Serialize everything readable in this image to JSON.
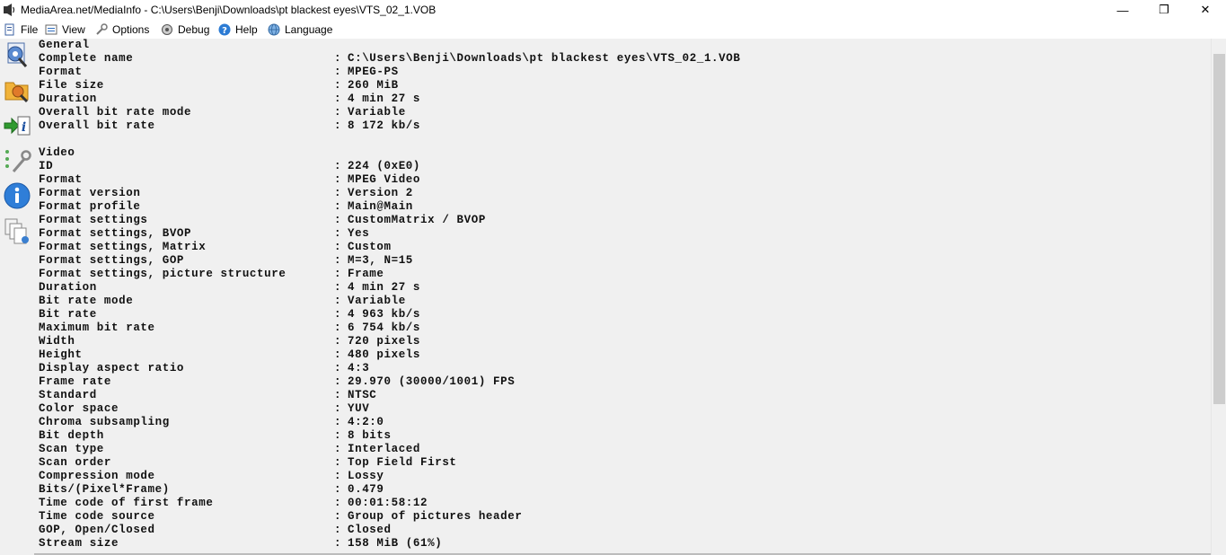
{
  "window": {
    "title": "MediaArea.net/MediaInfo - C:\\Users\\Benji\\Downloads\\pt blackest eyes\\VTS_02_1.VOB",
    "minimize_glyph": "—",
    "maximize_glyph": "❐",
    "close_glyph": "✕"
  },
  "menu": {
    "file": "File",
    "view": "View",
    "options": "Options",
    "debug": "Debug",
    "help": "Help",
    "language": "Language"
  },
  "sidebar": {
    "icons": [
      "open-file-icon",
      "open-folder-icon",
      "export-info-icon",
      "preferences-icon",
      "about-info-icon",
      "copy-files-icon"
    ]
  },
  "report": {
    "separator": ":",
    "rows": [
      {
        "k": "General",
        "v": ""
      },
      {
        "k": "Complete name",
        "v": "C:\\Users\\Benji\\Downloads\\pt blackest eyes\\VTS_02_1.VOB"
      },
      {
        "k": "Format",
        "v": "MPEG-PS"
      },
      {
        "k": "File size",
        "v": "260 MiB"
      },
      {
        "k": "Duration",
        "v": "4 min 27 s"
      },
      {
        "k": "Overall bit rate mode",
        "v": "Variable"
      },
      {
        "k": "Overall bit rate",
        "v": "8 172 kb/s"
      },
      {
        "k": "",
        "v": ""
      },
      {
        "k": "Video",
        "v": ""
      },
      {
        "k": "ID",
        "v": "224 (0xE0)"
      },
      {
        "k": "Format",
        "v": "MPEG Video"
      },
      {
        "k": "Format version",
        "v": "Version 2"
      },
      {
        "k": "Format profile",
        "v": "Main@Main"
      },
      {
        "k": "Format settings",
        "v": "CustomMatrix / BVOP"
      },
      {
        "k": "Format settings, BVOP",
        "v": "Yes"
      },
      {
        "k": "Format settings, Matrix",
        "v": "Custom"
      },
      {
        "k": "Format settings, GOP",
        "v": "M=3, N=15"
      },
      {
        "k": "Format settings, picture structure",
        "v": "Frame"
      },
      {
        "k": "Duration",
        "v": "4 min 27 s"
      },
      {
        "k": "Bit rate mode",
        "v": "Variable"
      },
      {
        "k": "Bit rate",
        "v": "4 963 kb/s"
      },
      {
        "k": "Maximum bit rate",
        "v": "6 754 kb/s"
      },
      {
        "k": "Width",
        "v": "720 pixels"
      },
      {
        "k": "Height",
        "v": "480 pixels"
      },
      {
        "k": "Display aspect ratio",
        "v": "4:3"
      },
      {
        "k": "Frame rate",
        "v": "29.970 (30000/1001) FPS"
      },
      {
        "k": "Standard",
        "v": "NTSC"
      },
      {
        "k": "Color space",
        "v": "YUV"
      },
      {
        "k": "Chroma subsampling",
        "v": "4:2:0"
      },
      {
        "k": "Bit depth",
        "v": "8 bits"
      },
      {
        "k": "Scan type",
        "v": "Interlaced"
      },
      {
        "k": "Scan order",
        "v": "Top Field First"
      },
      {
        "k": "Compression mode",
        "v": "Lossy"
      },
      {
        "k": "Bits/(Pixel*Frame)",
        "v": "0.479"
      },
      {
        "k": "Time code of first frame",
        "v": "00:01:58:12"
      },
      {
        "k": "Time code source",
        "v": "Group of pictures header"
      },
      {
        "k": "GOP, Open/Closed",
        "v": "Closed"
      },
      {
        "k": "Stream size",
        "v": "158 MiB (61%)"
      }
    ]
  }
}
